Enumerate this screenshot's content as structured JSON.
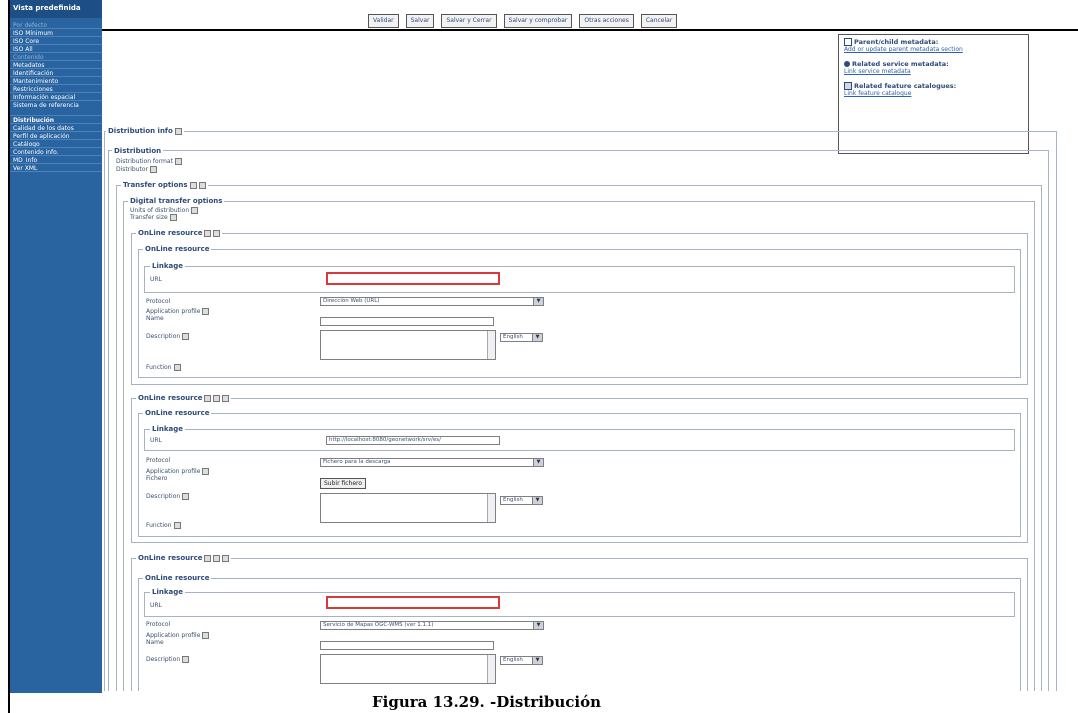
{
  "toolbar": {
    "buttons": [
      "Validar",
      "Salvar",
      "Salvar y Cerrar",
      "Salvar y comprobar",
      "Otras acciones",
      "Cancelar"
    ]
  },
  "sidebar": {
    "title": "Vista predefinida",
    "items": [
      "Por defecto",
      "ISO Mínimum",
      "ISO Core",
      "ISO All",
      "Contenido",
      "Metadatos",
      "Identificación",
      "Mantenimiento",
      "Restricciones",
      "Información espacial",
      "Sistema de referencia",
      "Distribución",
      "Calidad de los datos",
      "Perfil de aplicación",
      "Catálogo",
      "Contenido info.",
      "MD_Info",
      "Ver XML"
    ]
  },
  "related": {
    "parent_title": "Parent/child metadata:",
    "parent_link": "Add or update parent metadata section",
    "service_title": "Related service metadata:",
    "service_link": "Link service metadata",
    "feature_title": "Related feature catalogues:",
    "feature_link": "Link feature catalogue"
  },
  "form": {
    "distribution_info": "Distribution info",
    "distribution": "Distribution",
    "distribution_format": "Distribution format",
    "distributor": "Distributor",
    "transfer_options": "Transfer options",
    "digital_transfer_options": "Digital transfer options",
    "units_of_distribution": "Units of distribution",
    "transfer_size": "Transfer size",
    "online_resource": "OnLine resource",
    "linkage": "Linkage",
    "url": "URL",
    "protocol": "Protocol",
    "application_profile": "Application profile",
    "name": "Name",
    "description": "Description",
    "function": "Function",
    "fichero": "Fichero"
  },
  "resources": [
    {
      "protocol_value": "Dirección Web (URL)",
      "url_value": "",
      "language": "English"
    },
    {
      "protocol_value": "Fichero para la descarga",
      "url_value": "http://localhost:8080/geonetwork/srv/es/",
      "language": "English",
      "upload_label": "Subir fichero"
    },
    {
      "protocol_value": "Servicio de Mapas OGC-WMS (ver 1.1.1)",
      "url_value": "",
      "language": "English"
    }
  ],
  "caption": "Figura 13.29. -Distribución"
}
